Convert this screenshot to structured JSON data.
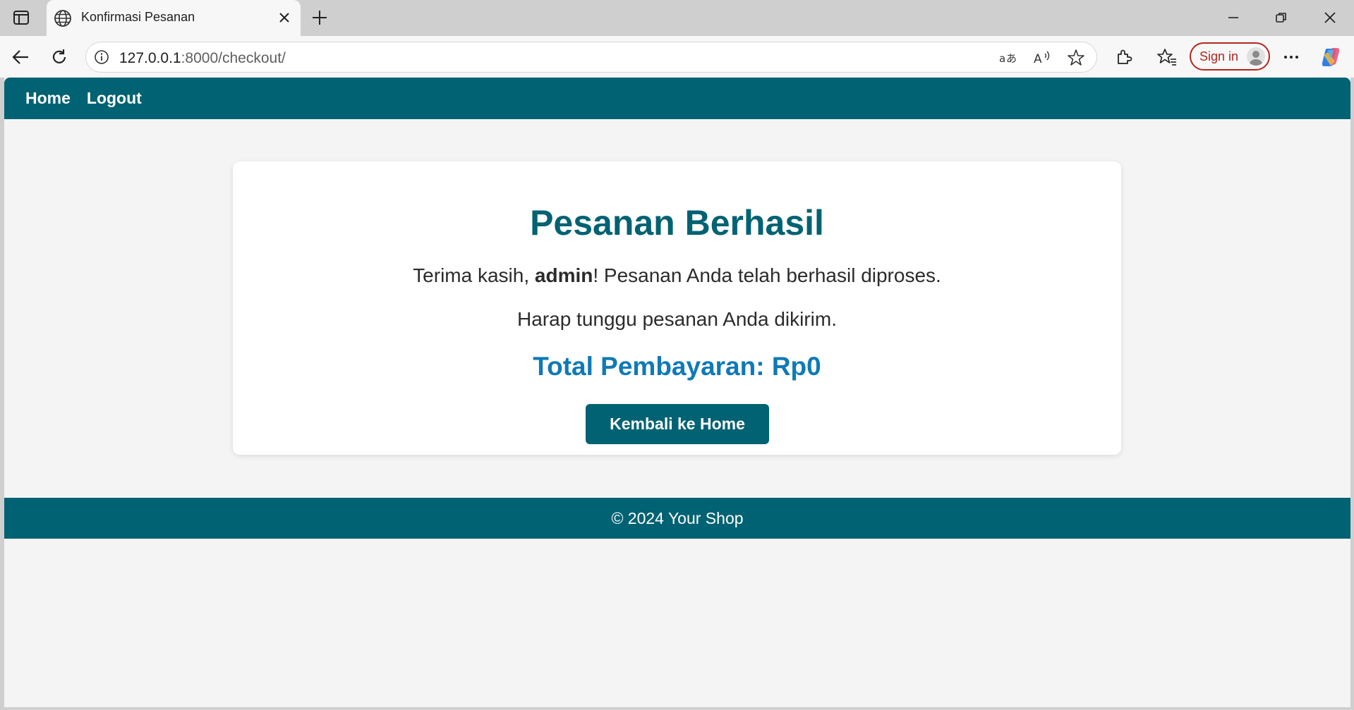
{
  "browser": {
    "tab_title": "Konfirmasi Pesanan",
    "url_host": "127.0.0.1",
    "url_rest": ":8000/checkout/",
    "sign_in_label": "Sign in"
  },
  "site": {
    "nav": {
      "home": "Home",
      "logout": "Logout"
    },
    "heading": "Pesanan Berhasil",
    "thanks_prefix": "Terima kasih, ",
    "username": "admin",
    "thanks_suffix": "! Pesanan Anda telah berhasil diproses.",
    "wait_message": "Harap tunggu pesanan Anda dikirim.",
    "total_label": "Total Pembayaran: Rp0",
    "back_button": "Kembali ke Home",
    "footer": "© 2024 Your Shop"
  },
  "colors": {
    "brand": "#006272",
    "total": "#0f7ab5",
    "signin": "#b3261e"
  },
  "icons": [
    "sidebar-toggle-icon",
    "globe-icon",
    "close-icon",
    "plus-icon",
    "minimize-icon",
    "restore-icon",
    "window-close-icon",
    "back-icon",
    "refresh-icon",
    "info-icon",
    "translate-icon",
    "read-aloud-icon",
    "star-icon",
    "extensions-icon",
    "favorites-icon",
    "avatar-icon",
    "more-icon",
    "copilot-icon"
  ]
}
